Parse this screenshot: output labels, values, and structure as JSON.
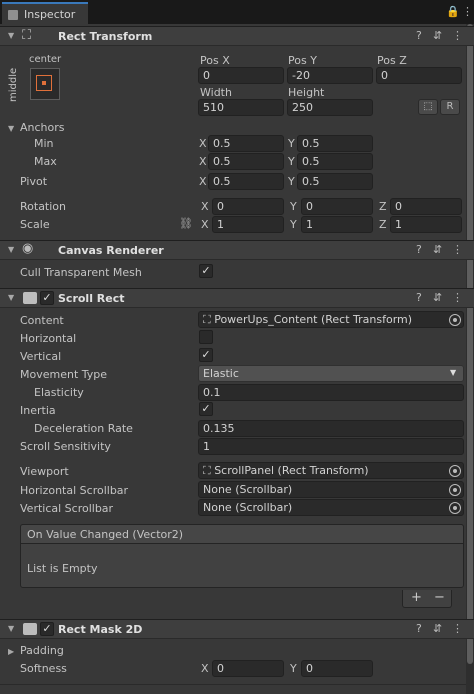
{
  "tab": {
    "title": "Inspector",
    "lock": "🔒",
    "menu": "⋮"
  },
  "rect_transform": {
    "title": "Rect Transform",
    "anchor_h": "center",
    "anchor_v": "middle",
    "pos_x_label": "Pos X",
    "pos_y_label": "Pos Y",
    "pos_z_label": "Pos Z",
    "pos_x": "0",
    "pos_y": "-20",
    "pos_z": "0",
    "width_label": "Width",
    "height_label": "Height",
    "width": "510",
    "height": "250",
    "r_btn": "R",
    "anchors_label": "Anchors",
    "min_label": "Min",
    "max_label": "Max",
    "min_x": "0.5",
    "min_y": "0.5",
    "max_x": "0.5",
    "max_y": "0.5",
    "pivot_label": "Pivot",
    "pivot_x": "0.5",
    "pivot_y": "0.5",
    "rotation_label": "Rotation",
    "rot_x": "0",
    "rot_y": "0",
    "rot_z": "0",
    "scale_label": "Scale",
    "scale_x": "1",
    "scale_y": "1",
    "scale_z": "1"
  },
  "canvas_renderer": {
    "title": "Canvas Renderer",
    "cull_label": "Cull Transparent Mesh",
    "cull_checked": "✓"
  },
  "scroll_rect": {
    "title": "Scroll Rect",
    "enabled": "✓",
    "content_label": "Content",
    "content_value": "PowerUps_Content (Rect Transform)",
    "horizontal_label": "Horizontal",
    "vertical_label": "Vertical",
    "vertical_checked": "✓",
    "movement_label": "Movement Type",
    "movement_value": "Elastic",
    "elasticity_label": "Elasticity",
    "elasticity_value": "0.1",
    "inertia_label": "Inertia",
    "inertia_checked": "✓",
    "decel_label": "Deceleration Rate",
    "decel_value": "0.135",
    "sensitivity_label": "Scroll Sensitivity",
    "sensitivity_value": "1",
    "viewport_label": "Viewport",
    "viewport_value": "ScrollPanel (Rect Transform)",
    "hscroll_label": "Horizontal Scrollbar",
    "hscroll_value": "None (Scrollbar)",
    "vscroll_label": "Vertical Scrollbar",
    "vscroll_value": "None (Scrollbar)",
    "event_title": "On Value Changed (Vector2)",
    "event_empty": "List is Empty",
    "plus": "+",
    "minus": "−"
  },
  "rect_mask": {
    "title": "Rect Mask 2D",
    "enabled": "✓",
    "padding_label": "Padding",
    "softness_label": "Softness",
    "soft_x": "0",
    "soft_y": "0"
  },
  "axis": {
    "x": "X",
    "y": "Y",
    "z": "Z"
  },
  "icons": {
    "help": "?",
    "preset": "⇵",
    "more": "⋮",
    "fold_open": "▼",
    "fold_closed": "▶",
    "link": "⛓"
  }
}
